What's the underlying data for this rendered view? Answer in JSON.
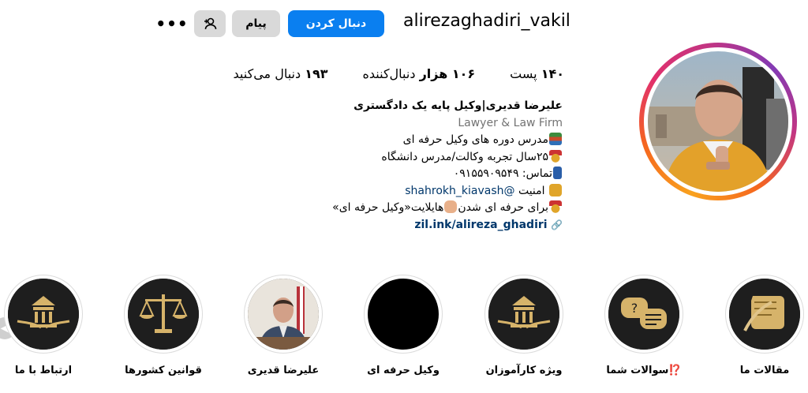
{
  "profile": {
    "username": "alirezaghadiri_vakil",
    "follow_label": "دنبال کردن",
    "message_label": "پیام",
    "suggest_icon": "person-add-icon",
    "more_icon": "more-icon",
    "more_label": "•••"
  },
  "stats": {
    "posts": {
      "value": "۱۴۰",
      "label": "پست"
    },
    "followers": {
      "value": "۱۰۶ هزار",
      "label": "دنبال‌کننده"
    },
    "following": {
      "value": "۱۹۳",
      "label": "دنبال می‌کنید"
    }
  },
  "bio": {
    "name": "علیرضا قدیری|وکیل پایه یک دادگستری",
    "category": "Lawyer & Law Firm",
    "line1": "مدرس دوره های وکیل حرفه ای",
    "line2": "۲۵سال تجربه وکالت/مدرس دانشگاه",
    "line3": "تماس: ۰۹۱۵۵۹۰۹۵۴۹",
    "line4_mention": "@shahrokh_kiavash",
    "line4_text": "امنیت",
    "line5": "برای حرفه ای شدن",
    "line5b": "هایلایت«وکیل حرفه ای»",
    "link": "zil.ink/alireza_ghadiri",
    "link_icon": "link-icon"
  },
  "highlights": [
    {
      "label": "مقالات ما",
      "icon": "scroll-icon"
    },
    {
      "label": "⁉️سوالات شما",
      "icon": "speech-bubbles-icon"
    },
    {
      "label": "ویژه کارآموزان",
      "icon": "law-emblem-icon"
    },
    {
      "label": "وکیل حرفه ای",
      "icon": "black-circle"
    },
    {
      "label": "علیرضا قدیری",
      "icon": "portrait-photo"
    },
    {
      "label": "قوانین کشورها",
      "icon": "scales-icon"
    },
    {
      "label": "ارتباط با ما",
      "icon": "law-emblem-icon"
    }
  ],
  "colors": {
    "follow_button": "#0a7ff0",
    "secondary_button": "#d9d9d9",
    "link": "#00376b",
    "category": "#737373"
  }
}
